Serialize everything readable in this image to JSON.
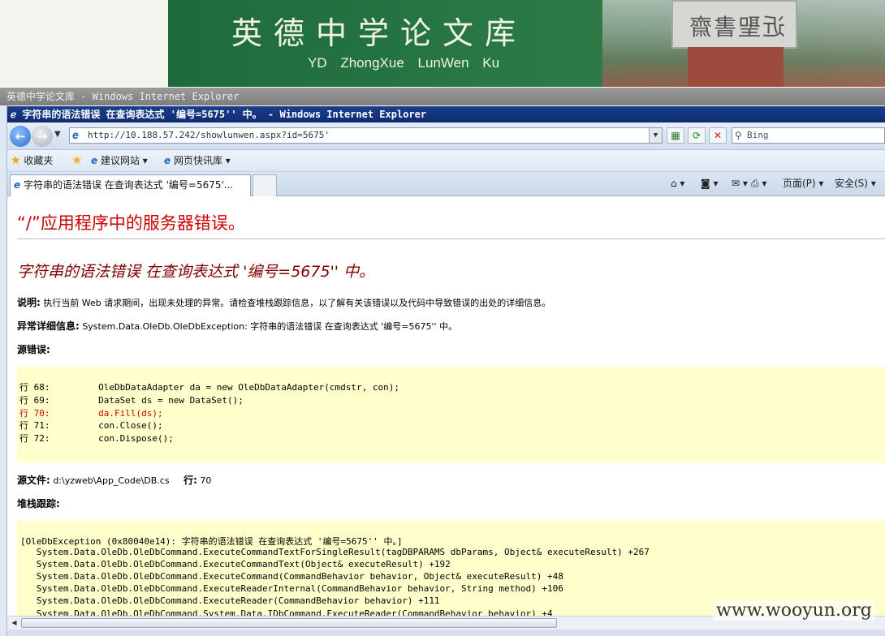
{
  "banner": {
    "title_cn": "英德中学论文库",
    "title_en": "YD  ZhongXue  LunWen    Ku",
    "stone_text": "近聖書齋"
  },
  "outer_window": {
    "title": "英德中学论文库 - Windows Internet Explorer"
  },
  "inner_window": {
    "title": "字符串的语法错误 在查询表达式 '编号=5675'' 中。 - Windows Internet Explorer"
  },
  "address_bar": {
    "url": "http://10.188.57.242/showlunwen.aspx?id=5675'",
    "search_placeholder": "Bing"
  },
  "favorites_bar": {
    "favorites_label": "收藏夹",
    "items": [
      {
        "label": "建议网站 ▾"
      },
      {
        "label": "网页快讯库 ▾"
      }
    ]
  },
  "tabs": {
    "active_label": "字符串的语法错误 在查询表达式 '编号=5675'...",
    "commands": {
      "page": "页面(P) ▾",
      "safety": "安全(S) ▾"
    }
  },
  "page": {
    "error_title": "“/”应用程序中的服务器错误。",
    "error_heading": "字符串的语法错误 在查询表达式 '编号=5675'' 中。",
    "description_label": "说明:",
    "description_text": "执行当前 Web 请求期间，出现未处理的异常。请检查堆栈跟踪信息，以了解有关该错误以及代码中导致错误的出处的详细信息。",
    "exception_label": "异常详细信息:",
    "exception_text": "System.Data.OleDb.OleDbException: 字符串的语法错误 在查询表达式 '编号=5675'' 中。",
    "source_error_label": "源错误:",
    "code_lines": [
      "行 68:         OleDbDataAdapter da = new OleDbDataAdapter(cmdstr, con);",
      "行 69:         DataSet ds = new DataSet();",
      "行 70:         da.Fill(ds);",
      "行 71:         con.Close();",
      "行 72:         con.Dispose();"
    ],
    "source_file_label": "源文件:",
    "source_file_value": "d:\\yzweb\\App_Code\\DB.cs",
    "line_label": "行:",
    "line_value": "70",
    "stack_label": "堆栈跟踪:",
    "stack_lines": [
      "[OleDbException (0x80040e14): 字符串的语法错误 在查询表达式 '编号=5675'' 中。]",
      "   System.Data.OleDb.OleDbCommand.ExecuteCommandTextForSingleResult(tagDBPARAMS dbParams, Object& executeResult) +267",
      "   System.Data.OleDb.OleDbCommand.ExecuteCommandText(Object& executeResult) +192",
      "   System.Data.OleDb.OleDbCommand.ExecuteCommand(CommandBehavior behavior, Object& executeResult) +48",
      "   System.Data.OleDb.OleDbCommand.ExecuteReaderInternal(CommandBehavior behavior, String method) +106",
      "   System.Data.OleDb.OleDbCommand.ExecuteReader(CommandBehavior behavior) +111",
      "   System.Data.OleDb.OleDbCommand.System.Data.IDbCommand.ExecuteReader(CommandBehavior behavior) +4"
    ]
  },
  "watermark": "www.wooyun.org"
}
